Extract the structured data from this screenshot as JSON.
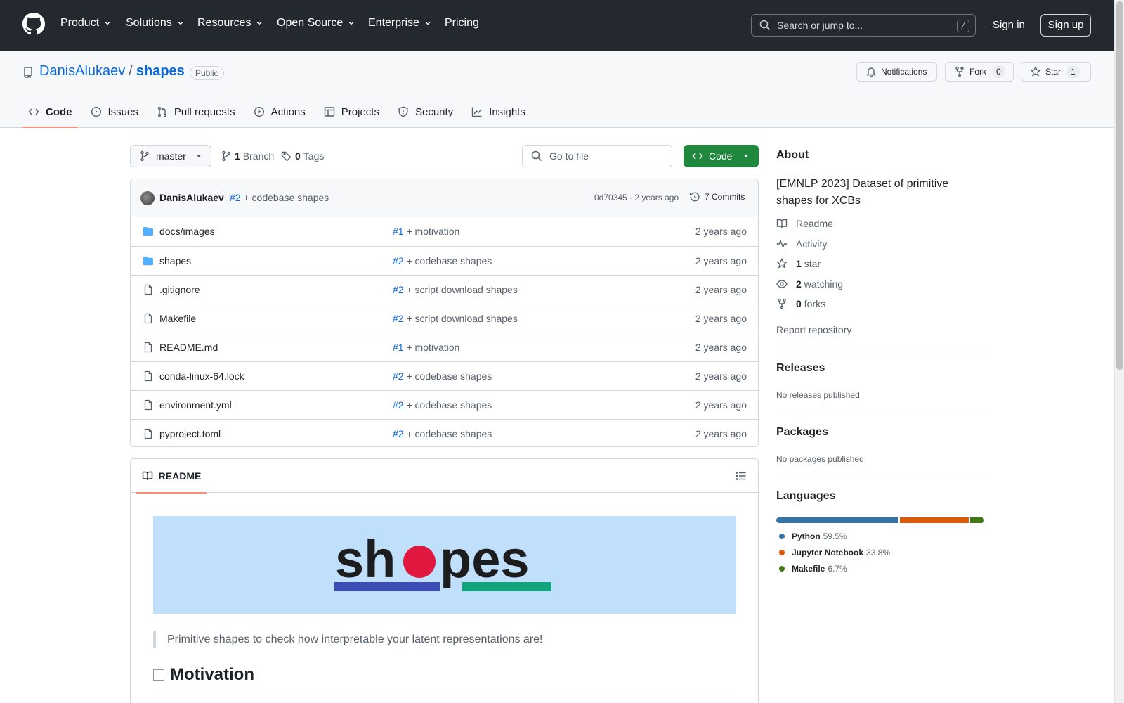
{
  "header": {
    "nav": [
      {
        "label": "Product",
        "has_menu": true
      },
      {
        "label": "Solutions",
        "has_menu": true
      },
      {
        "label": "Resources",
        "has_menu": true
      },
      {
        "label": "Open Source",
        "has_menu": true
      },
      {
        "label": "Enterprise",
        "has_menu": true
      },
      {
        "label": "Pricing",
        "has_menu": false
      }
    ],
    "search_placeholder": "Search or jump to...",
    "search_shortcut": "/",
    "sign_in": "Sign in",
    "sign_up": "Sign up"
  },
  "repo": {
    "owner": "DanisAlukaev",
    "separator": "/",
    "name": "shapes",
    "visibility": "Public",
    "notifications_label": "Notifications",
    "fork_label": "Fork",
    "fork_count": "0",
    "star_label": "Star",
    "star_count": "1"
  },
  "tabs": [
    {
      "label": "Code",
      "icon": "code-icon",
      "active": true
    },
    {
      "label": "Issues",
      "icon": "issue-icon",
      "active": false
    },
    {
      "label": "Pull requests",
      "icon": "pull-request-icon",
      "active": false
    },
    {
      "label": "Actions",
      "icon": "play-icon",
      "active": false
    },
    {
      "label": "Projects",
      "icon": "table-icon",
      "active": false
    },
    {
      "label": "Security",
      "icon": "shield-icon",
      "active": false
    },
    {
      "label": "Insights",
      "icon": "graph-icon",
      "active": false
    }
  ],
  "browser": {
    "branch": "master",
    "branch_count": "1",
    "branch_label": "Branch",
    "tag_count": "0",
    "tag_label": "Tags",
    "goto_placeholder": "Go to file",
    "code_button": "Code"
  },
  "last_commit": {
    "author": "DanisAlukaev",
    "pr": "#2",
    "message": "+ codebase shapes",
    "hash_time": "0d70345 · 2 years ago",
    "commits": "7 Commits"
  },
  "files": [
    {
      "name": "docs/images",
      "type": "folder",
      "pr": "#1",
      "message": "+ motivation",
      "time": "2 years ago"
    },
    {
      "name": "shapes",
      "type": "folder",
      "pr": "#2",
      "message": "+ codebase shapes",
      "time": "2 years ago"
    },
    {
      "name": ".gitignore",
      "type": "file",
      "pr": "#2",
      "message": "+ script download shapes",
      "time": "2 years ago"
    },
    {
      "name": "Makefile",
      "type": "file",
      "pr": "#2",
      "message": "+ script download shapes",
      "time": "2 years ago"
    },
    {
      "name": "README.md",
      "type": "file",
      "pr": "#1",
      "message": "+ motivation",
      "time": "2 years ago"
    },
    {
      "name": "conda-linux-64.lock",
      "type": "file",
      "pr": "#2",
      "message": "+ codebase shapes",
      "time": "2 years ago"
    },
    {
      "name": "environment.yml",
      "type": "file",
      "pr": "#2",
      "message": "+ codebase shapes",
      "time": "2 years ago"
    },
    {
      "name": "pyproject.toml",
      "type": "file",
      "pr": "#2",
      "message": "+ codebase shapes",
      "time": "2 years ago"
    }
  ],
  "readme": {
    "tab_label": "README",
    "banner_text": "shapes",
    "quote": "Primitive shapes to check how interpretable your latent representations are!",
    "heading": "Motivation"
  },
  "about": {
    "title": "About",
    "description": "[EMNLP 2023] Dataset of primitive shapes for XCBs",
    "links": [
      {
        "icon": "book-icon",
        "count": "",
        "label": "Readme"
      },
      {
        "icon": "pulse-icon",
        "count": "",
        "label": "Activity"
      },
      {
        "icon": "star-icon",
        "count": "1",
        "label": "star"
      },
      {
        "icon": "eye-icon",
        "count": "2",
        "label": "watching"
      },
      {
        "icon": "fork-icon",
        "count": "0",
        "label": "forks"
      }
    ],
    "report": "Report repository"
  },
  "releases": {
    "title": "Releases",
    "empty": "No releases published"
  },
  "packages": {
    "title": "Packages",
    "empty": "No packages published"
  },
  "languages": {
    "title": "Languages",
    "items": [
      {
        "name": "Python",
        "percent": "59.5%",
        "fraction": 0.595,
        "color": "#3572A5"
      },
      {
        "name": "Jupyter Notebook",
        "percent": "33.8%",
        "fraction": 0.338,
        "color": "#DA5B0B"
      },
      {
        "name": "Makefile",
        "percent": "6.7%",
        "fraction": 0.067,
        "color": "#427819"
      }
    ]
  },
  "colors": {
    "header_bg": "#24292f",
    "link": "#0969da",
    "primary_button": "#1f883d",
    "active_tab_underline": "#fd8c73",
    "banner_bg": "#bfdffa"
  }
}
